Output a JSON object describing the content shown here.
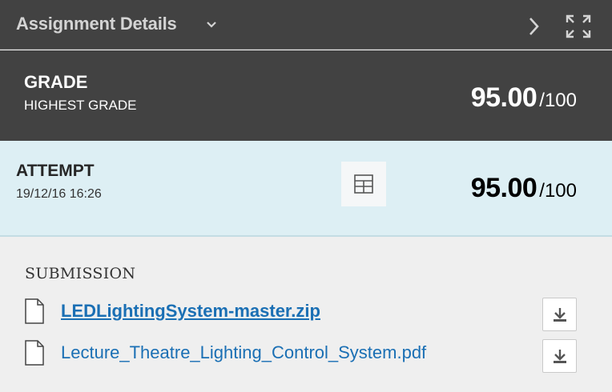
{
  "header": {
    "title": "Assignment Details",
    "icons": [
      "chevron-down-icon",
      "chevron-right-icon",
      "expand-icon"
    ]
  },
  "grade": {
    "title": "GRADE",
    "subtitle": "HIGHEST GRADE",
    "score": "95.00",
    "out_of": "/100"
  },
  "attempt": {
    "title": "ATTEMPT",
    "date": "19/12/16 16:26",
    "score": "95.00",
    "out_of": "/100",
    "icon": "grid-icon"
  },
  "submission": {
    "heading": "SUBMISSION",
    "files": [
      {
        "name": "LEDLightingSystem-master.zip",
        "icon": "file-icon",
        "action_icon": "download-icon"
      },
      {
        "name": "Lecture_Theatre_Lighting_Control_System.pdf",
        "icon": "file-icon",
        "action_icon": "download-icon"
      }
    ]
  },
  "colors": {
    "dark_panel": "#424242",
    "attempt_bg": "#ddeff4",
    "link": "#1a6fb4",
    "body_bg": "#efefef"
  }
}
